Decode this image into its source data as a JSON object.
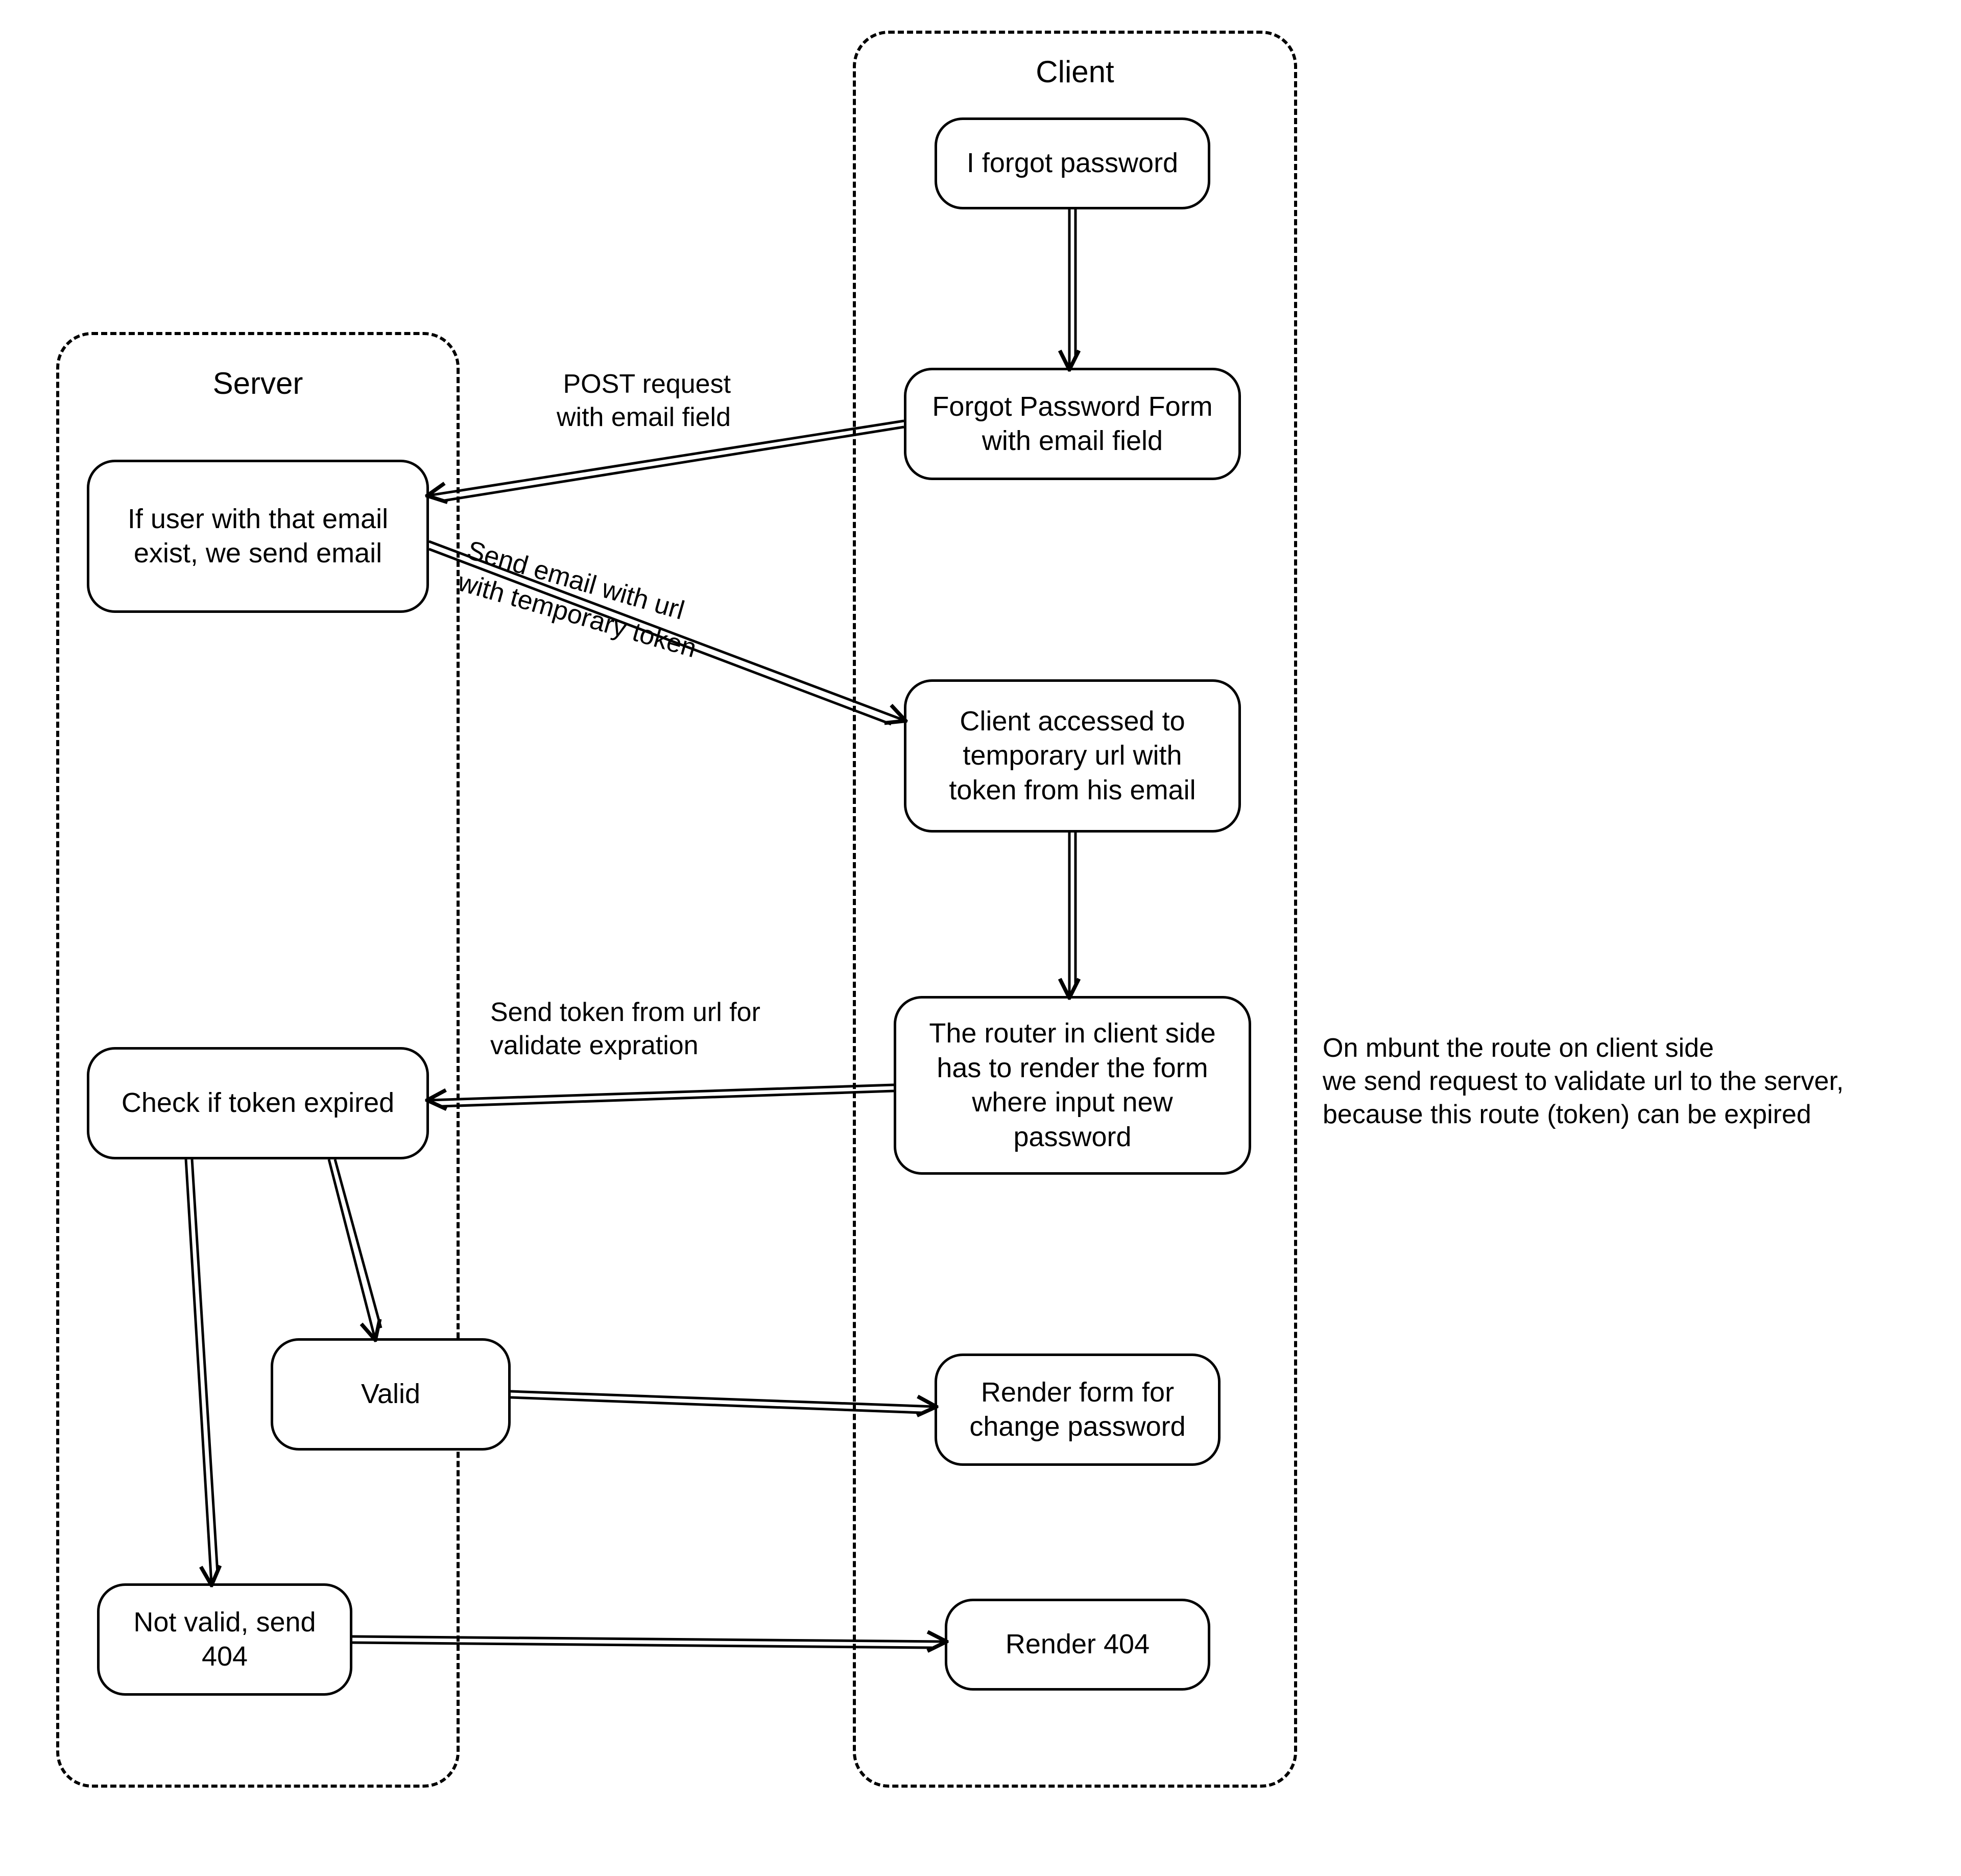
{
  "lanes": {
    "server": {
      "title": "Server"
    },
    "client": {
      "title": "Client"
    }
  },
  "nodes": {
    "forgot_btn": "I forgot password",
    "forgot_form": "Forgot Password Form\nwith email field",
    "if_user_exist": "If user with that\nemail exist, we send\nemail",
    "client_accessed": "Client accessed to\ntemporary url with\ntoken from his email",
    "router_render": "The router in client\nside has to render the\nform where input new\npassword",
    "check_expired": "Check if token expired",
    "valid": "Valid",
    "not_valid": "Not valid, send\n404",
    "render_form": "Render form for\nchange password",
    "render_404": "Render 404"
  },
  "edges": {
    "post_request": "POST request\nwith email field",
    "send_email": "Send email with url\nwith temporary token",
    "send_token": "Send token from url for\nvalidate expration",
    "on_mount_note": "On mbunt the route on client side\nwe send request to validate url to the server,\nbecause this route (token) can be expired"
  }
}
